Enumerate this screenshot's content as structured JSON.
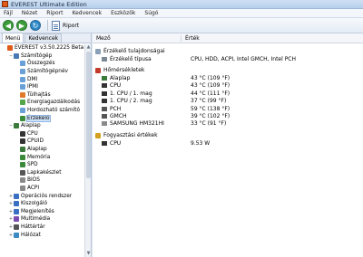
{
  "window": {
    "title": "EVEREST Ultimate Edition"
  },
  "menu": [
    "Fájl",
    "Nézet",
    "Riport",
    "Kedvencek",
    "Eszközök",
    "Súgó"
  ],
  "toolbar": {
    "report_label": "Riport"
  },
  "left_tabs": [
    "Menü",
    "Kedvencek"
  ],
  "tree": [
    {
      "label": "EVEREST v3.50.2225 Beta",
      "level": 0,
      "exp": "",
      "icon": "everest-icon",
      "color": "#e05a1a"
    },
    {
      "label": "Számítógép",
      "level": 1,
      "exp": "−",
      "icon": "computer-icon",
      "color": "#4a79b8"
    },
    {
      "label": "Összegzés",
      "level": 2,
      "exp": "",
      "icon": "summary-icon",
      "color": "#6aa0d8"
    },
    {
      "label": "Számítógépnév",
      "level": 2,
      "exp": "",
      "icon": "computer-name-icon",
      "color": "#6aa0d8"
    },
    {
      "label": "DMI",
      "level": 2,
      "exp": "",
      "icon": "dmi-icon",
      "color": "#6aa0d8"
    },
    {
      "label": "IPMI",
      "level": 2,
      "exp": "",
      "icon": "ipmi-icon",
      "color": "#6aa0d8"
    },
    {
      "label": "Túlhajtás",
      "level": 2,
      "exp": "",
      "icon": "overclock-icon",
      "color": "#e07a2a"
    },
    {
      "label": "Energiagazdálkodás",
      "level": 2,
      "exp": "",
      "icon": "power-icon",
      "color": "#55a64a"
    },
    {
      "label": "Hordozható számító",
      "level": 2,
      "exp": "",
      "icon": "portable-icon",
      "color": "#6aa0d8"
    },
    {
      "label": "Érzékelő",
      "level": 2,
      "exp": "",
      "icon": "sensor-icon",
      "color": "#3d8b3d",
      "selected": true
    },
    {
      "label": "Alaplap",
      "level": 1,
      "exp": "−",
      "icon": "motherboard-icon",
      "color": "#3a7a3a"
    },
    {
      "label": "CPU",
      "level": 2,
      "exp": "",
      "icon": "cpu-icon",
      "color": "#333333"
    },
    {
      "label": "CPUID",
      "level": 2,
      "exp": "",
      "icon": "cpuid-icon",
      "color": "#333333"
    },
    {
      "label": "Alaplap",
      "level": 2,
      "exp": "",
      "icon": "motherboard-icon",
      "color": "#3a7a3a"
    },
    {
      "label": "Memória",
      "level": 2,
      "exp": "",
      "icon": "memory-icon",
      "color": "#3a8a3a"
    },
    {
      "label": "SPD",
      "level": 2,
      "exp": "",
      "icon": "spd-icon",
      "color": "#3a8a3a"
    },
    {
      "label": "Lapkakészlet",
      "level": 2,
      "exp": "",
      "icon": "chipset-icon",
      "color": "#555555"
    },
    {
      "label": "BIOS",
      "level": 2,
      "exp": "",
      "icon": "bios-icon",
      "color": "#8a8a8a"
    },
    {
      "label": "ACPI",
      "level": 2,
      "exp": "",
      "icon": "acpi-icon",
      "color": "#8a8a8a"
    },
    {
      "label": "Operációs rendszer",
      "level": 1,
      "exp": "+",
      "icon": "os-icon",
      "color": "#3b6fc2"
    },
    {
      "label": "Kiszolgáló",
      "level": 1,
      "exp": "+",
      "icon": "server-icon",
      "color": "#3b6fc2"
    },
    {
      "label": "Megjelenítés",
      "level": 1,
      "exp": "+",
      "icon": "display-icon",
      "color": "#3b6fc2"
    },
    {
      "label": "Multimédia",
      "level": 1,
      "exp": "+",
      "icon": "multimedia-icon",
      "color": "#7a4ab0"
    },
    {
      "label": "Háttértár",
      "level": 1,
      "exp": "+",
      "icon": "storage-icon",
      "color": "#555555"
    },
    {
      "label": "Hálózat",
      "level": 1,
      "exp": "+",
      "icon": "network-icon",
      "color": "#3b8ac2"
    }
  ],
  "columns": {
    "field": "Mező",
    "value": "Érték"
  },
  "sections": [
    {
      "title": "Érzékelő tulajdonságai",
      "icon": "sensor-props-icon",
      "color": "#8aa0b8",
      "rows": [
        {
          "field": "Érzékelő típusa",
          "value": "CPU, HDD, ACPI, Intel GMCH, Intel PCH",
          "icon": "sensor-type-icon",
          "color": "#7d8a96"
        }
      ]
    },
    {
      "title": "Hőmérsékletek",
      "icon": "thermometer-icon",
      "color": "#c23b2a",
      "rows": [
        {
          "field": "Alaplap",
          "value": "43 °C  (109 °F)",
          "icon": "motherboard-icon",
          "color": "#3a7a3a"
        },
        {
          "field": "CPU",
          "value": "43 °C  (109 °F)",
          "icon": "cpu-icon",
          "color": "#333333"
        },
        {
          "field": "1. CPU / 1. mag",
          "value": "44 °C  (111 °F)",
          "icon": "cpu-core-icon",
          "color": "#333333"
        },
        {
          "field": "1. CPU / 2. mag",
          "value": "37 °C  (99 °F)",
          "icon": "cpu-core-icon",
          "color": "#333333"
        },
        {
          "field": "PCH",
          "value": "59 °C  (138 °F)",
          "icon": "chipset-icon",
          "color": "#555555"
        },
        {
          "field": "GMCH",
          "value": "39 °C  (102 °F)",
          "icon": "chipset-icon",
          "color": "#555555"
        },
        {
          "field": "SAMSUNG HM321HI",
          "value": "33 °C  (91 °F)",
          "icon": "hdd-icon",
          "color": "#8a8a8a"
        }
      ]
    },
    {
      "title": "Fogyasztási értékek",
      "icon": "power-values-icon",
      "color": "#d4a020",
      "rows": [
        {
          "field": "CPU",
          "value": "9.53 W",
          "icon": "cpu-icon",
          "color": "#333333"
        }
      ]
    }
  ],
  "colors": {
    "back": "#3a9c3a",
    "forward": "#3a9c3a",
    "refresh": "#2f8ac9",
    "selection": "#cfe2f8"
  }
}
